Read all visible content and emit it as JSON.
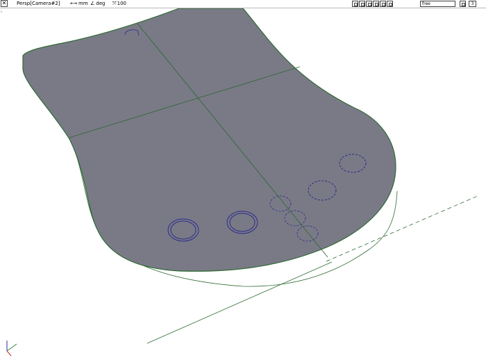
{
  "viewport_title": "Persp[Camera#2]",
  "length_unit": "mm",
  "angle_unit": "deg",
  "scale_value": "100",
  "mode_value": "free",
  "count_value": "3",
  "icons": [
    "close-icon",
    "unit-icon",
    "angle-icon",
    "scale-icon",
    "undo-view-icon",
    "print-icon",
    "zoom-icon",
    "zoom-window-icon",
    "fit-icon",
    "move-icon",
    "layer-icon"
  ],
  "colors": {
    "surface": "#7a7a87",
    "edge": "#2e6a32",
    "hole": "#2a2a8a"
  }
}
